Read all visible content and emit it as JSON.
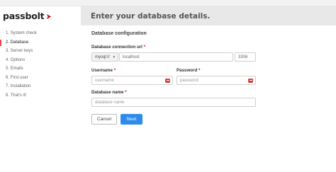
{
  "brand": {
    "name": "passbolt",
    "accent": "#d40101"
  },
  "header": {
    "title": "Enter your database details."
  },
  "sidebar": {
    "steps": [
      {
        "label": "1. System check",
        "active": false
      },
      {
        "label": "2. Database",
        "active": true
      },
      {
        "label": "3. Server keys",
        "active": false
      },
      {
        "label": "4. Options",
        "active": false
      },
      {
        "label": "5. Emails",
        "active": false
      },
      {
        "label": "6. First user",
        "active": false
      },
      {
        "label": "7. Installation",
        "active": false
      },
      {
        "label": "8. That's it!",
        "active": false
      }
    ]
  },
  "form": {
    "section_title": "Database configuration",
    "connection": {
      "label": "Database connection url",
      "required_mark": "*",
      "scheme": "mysql://",
      "host_value": "localhost",
      "port_value": "3306"
    },
    "username": {
      "label": "Username",
      "required_mark": "*",
      "placeholder": "username"
    },
    "password": {
      "label": "Password",
      "required_mark": "*",
      "placeholder": "password"
    },
    "database_name": {
      "label": "Database name",
      "required_mark": "*",
      "placeholder": "database name"
    }
  },
  "buttons": {
    "cancel": "Cancel",
    "next": "Next"
  }
}
